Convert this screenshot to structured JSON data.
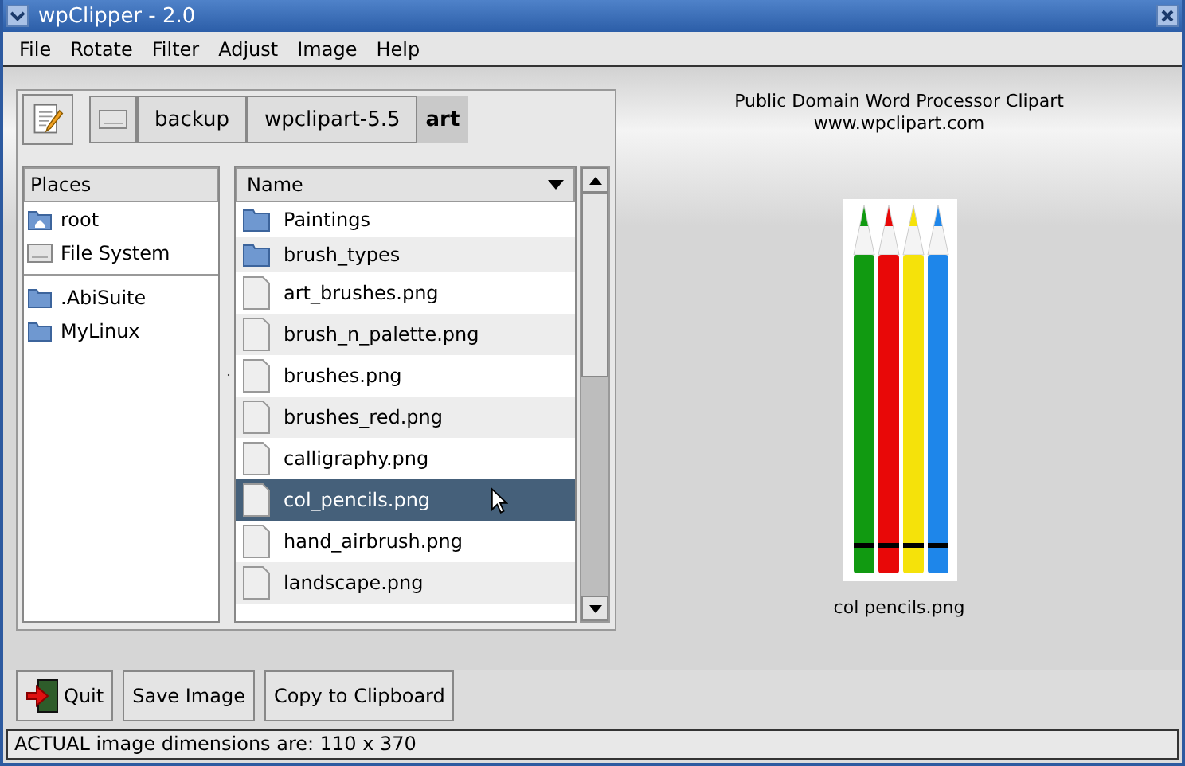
{
  "window": {
    "title": "wpClipper - 2.0"
  },
  "menu": [
    "File",
    "Rotate",
    "Filter",
    "Adjust",
    "Image",
    "Help"
  ],
  "path_bar": [
    {
      "label": "backup",
      "selected": false
    },
    {
      "label": "wpclipart-5.5",
      "selected": false
    },
    {
      "label": "art",
      "selected": true
    }
  ],
  "places": {
    "header": "Places",
    "items": [
      {
        "label": "root",
        "kind": "home"
      },
      {
        "label": "File System",
        "kind": "drive"
      },
      {
        "label": ".AbiSuite",
        "kind": "folder"
      },
      {
        "label": "MyLinux",
        "kind": "folder"
      }
    ]
  },
  "files": {
    "header": "Name",
    "rows": [
      {
        "name": "Paintings",
        "kind": "folder",
        "selected": false
      },
      {
        "name": "brush_types",
        "kind": "folder",
        "selected": false
      },
      {
        "name": "art_brushes.png",
        "kind": "file",
        "selected": false
      },
      {
        "name": "brush_n_palette.png",
        "kind": "file",
        "selected": false
      },
      {
        "name": "brushes.png",
        "kind": "file",
        "selected": false
      },
      {
        "name": "brushes_red.png",
        "kind": "file",
        "selected": false
      },
      {
        "name": "calligraphy.png",
        "kind": "file",
        "selected": false
      },
      {
        "name": "col_pencils.png",
        "kind": "file",
        "selected": true
      },
      {
        "name": "hand_airbrush.png",
        "kind": "file",
        "selected": false
      },
      {
        "name": "landscape.png",
        "kind": "file",
        "selected": false
      }
    ]
  },
  "preview": {
    "heading": "Public Domain Word Processor Clipart",
    "site": "www.wpclipart.com",
    "caption": "col pencils.png"
  },
  "buttons": [
    "Quit",
    "Save Image",
    "Copy to Clipboard"
  ],
  "status_bar": "ACTUAL image dimensions are: 110 x 370"
}
